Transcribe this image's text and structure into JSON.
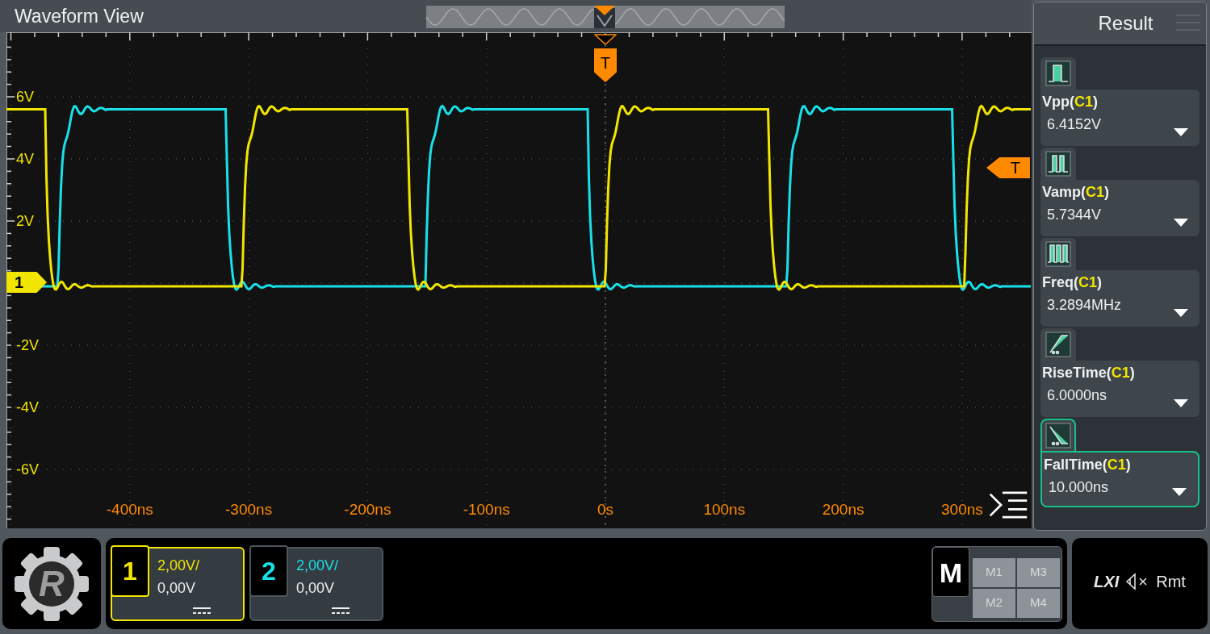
{
  "window": {
    "title": "Waveform View"
  },
  "markers": {
    "trigger_position": "T",
    "trigger_level": "T",
    "channel": "1"
  },
  "y_labels": [
    "6V",
    "4V",
    "2V",
    "-2V",
    "-4V",
    "-6V"
  ],
  "x_labels": [
    "-400ns",
    "-300ns",
    "-200ns",
    "-100ns",
    "0s",
    "100ns",
    "200ns",
    "300ns"
  ],
  "result_panel": {
    "title": "Result",
    "items": [
      {
        "kind": "vpp",
        "label": "Vpp(**C1**)",
        "value": "6.4152V",
        "selected": false
      },
      {
        "kind": "vamp",
        "label": "Vamp(**C1**)",
        "value": "5.7344V",
        "selected": false
      },
      {
        "kind": "freq",
        "label": "Freq(**C1**)",
        "value": "3.2894MHz",
        "selected": false
      },
      {
        "kind": "rise",
        "label": "RiseTime(**C1**)",
        "value": "6.0000ns",
        "selected": false
      },
      {
        "kind": "fall",
        "label": "FallTime(**C1**)",
        "value": "10.000ns",
        "selected": true
      }
    ]
  },
  "logo": {
    "letter": "R"
  },
  "channels": [
    {
      "number": "1",
      "scale": "2,00V/",
      "offset": "0,00V",
      "color": "#f2e600",
      "selected": true
    },
    {
      "number": "2",
      "scale": "2,00V/",
      "offset": "0,00V",
      "color": "#19e0e8",
      "selected": false
    }
  ],
  "math": {
    "label": "M",
    "buttons": [
      "M1",
      "M3",
      "M2",
      "M4"
    ]
  },
  "status": {
    "lxi": "LXI",
    "remote": "Rmt"
  }
}
